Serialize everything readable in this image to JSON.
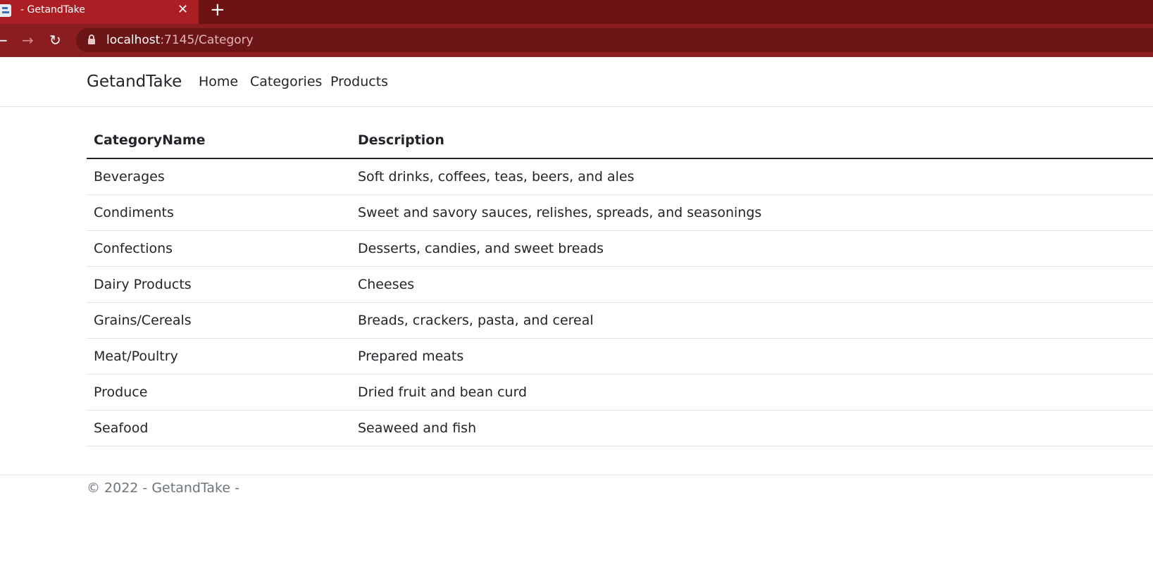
{
  "browser": {
    "tab_title": "- GetandTake",
    "tab_close": "✕",
    "new_tab": "+",
    "back": "←",
    "forward": "→",
    "reload": "↻",
    "url_host": "localhost",
    "url_path": ":7145/Category"
  },
  "navbar": {
    "brand": "GetandTake",
    "links": [
      "Home",
      "Categories",
      "Products"
    ]
  },
  "table": {
    "headers": [
      "CategoryName",
      "Description"
    ],
    "rows": [
      [
        "Beverages",
        "Soft drinks, coffees, teas, beers, and ales"
      ],
      [
        "Condiments",
        "Sweet and savory sauces, relishes, spreads, and seasonings"
      ],
      [
        "Confections",
        "Desserts, candies, and sweet breads"
      ],
      [
        "Dairy Products",
        "Cheeses"
      ],
      [
        "Grains/Cereals",
        "Breads, crackers, pasta, and cereal"
      ],
      [
        "Meat/Poultry",
        "Prepared meats"
      ],
      [
        "Produce",
        "Dried fruit and bean curd"
      ],
      [
        "Seafood",
        "Seaweed and fish"
      ]
    ]
  },
  "footer": {
    "text": "© 2022 - GetandTake -"
  },
  "colors": {
    "tabstrip": "#6e1214",
    "active_tab": "#ab1f24",
    "toolbar": "#891d20",
    "text": "#212529",
    "muted": "#6c757d"
  }
}
